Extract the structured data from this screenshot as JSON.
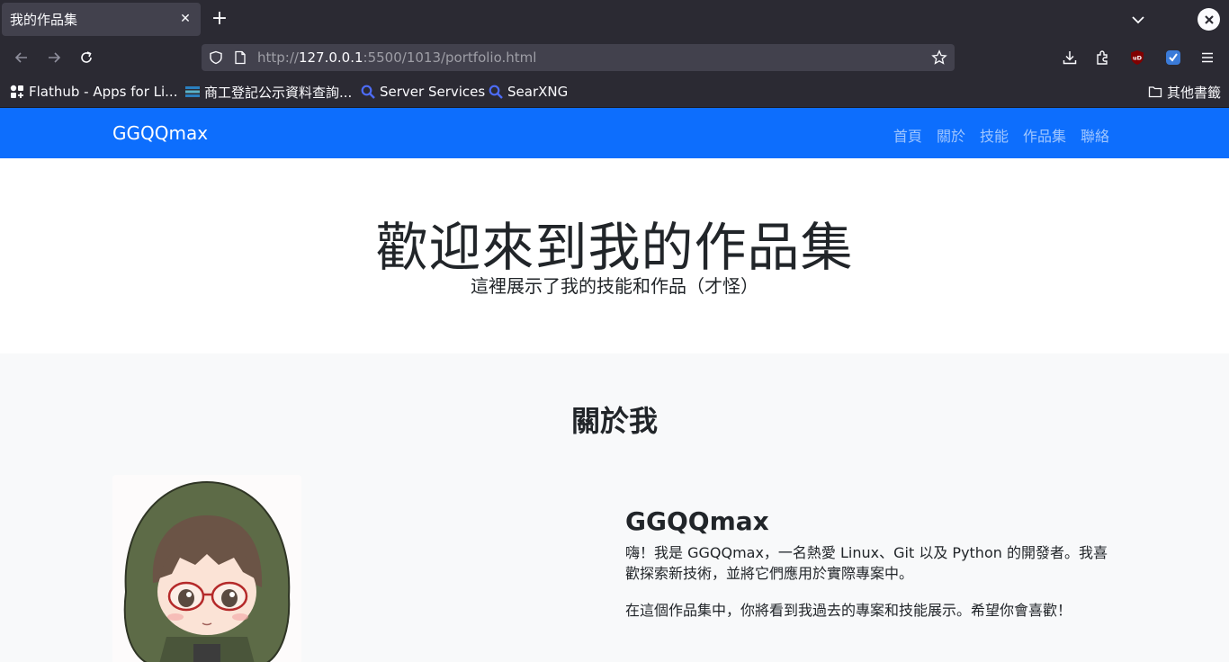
{
  "browser": {
    "tab_title": "我的作品集",
    "tab_close_glyph": "✕",
    "new_tab_glyph": "+",
    "url_scheme": "http://",
    "url_host": "127.0.0.1",
    "url_rest": ":5500/1013/portfolio.html",
    "bookmarks": [
      {
        "label": "Flathub - Apps for Li...",
        "icon": "flathub-icon"
      },
      {
        "label": "商工登記公示資料查詢...",
        "icon": "gov-site-icon"
      },
      {
        "label": "Server Services",
        "icon": "search-icon"
      },
      {
        "label": "SearXNG",
        "icon": "search-icon"
      }
    ],
    "other_bookmarks": "其他書籤",
    "icons": [
      "back-icon",
      "forward-icon",
      "reload-icon",
      "shield-icon",
      "page-icon",
      "star-icon",
      "download-icon",
      "extensions-icon",
      "ublock-icon",
      "bitwarden-icon",
      "menu-icon"
    ]
  },
  "site": {
    "brand": "GGQQmax",
    "nav": [
      "首頁",
      "關於",
      "技能",
      "作品集",
      "聯絡"
    ],
    "hero": {
      "title": "歡迎來到我的作品集",
      "subtitle": "這裡展示了我的技能和作品（才怪）"
    },
    "about": {
      "heading": "關於我",
      "name": "GGQQmax",
      "paragraph1": "嗨！我是 GGQQmax，一名熱愛 Linux、Git 以及 Python 的開發者。我喜歡探索新技術，並將它們應用於實際專案中。",
      "paragraph2": "在這個作品集中，你將看到我過去的專案和技能展示。希望你會喜歡！"
    }
  },
  "colors": {
    "chrome_bg": "#2b2a33",
    "chrome_field": "#42414d",
    "site_primary": "#0d6efd",
    "about_bg": "#f8f9fa"
  }
}
